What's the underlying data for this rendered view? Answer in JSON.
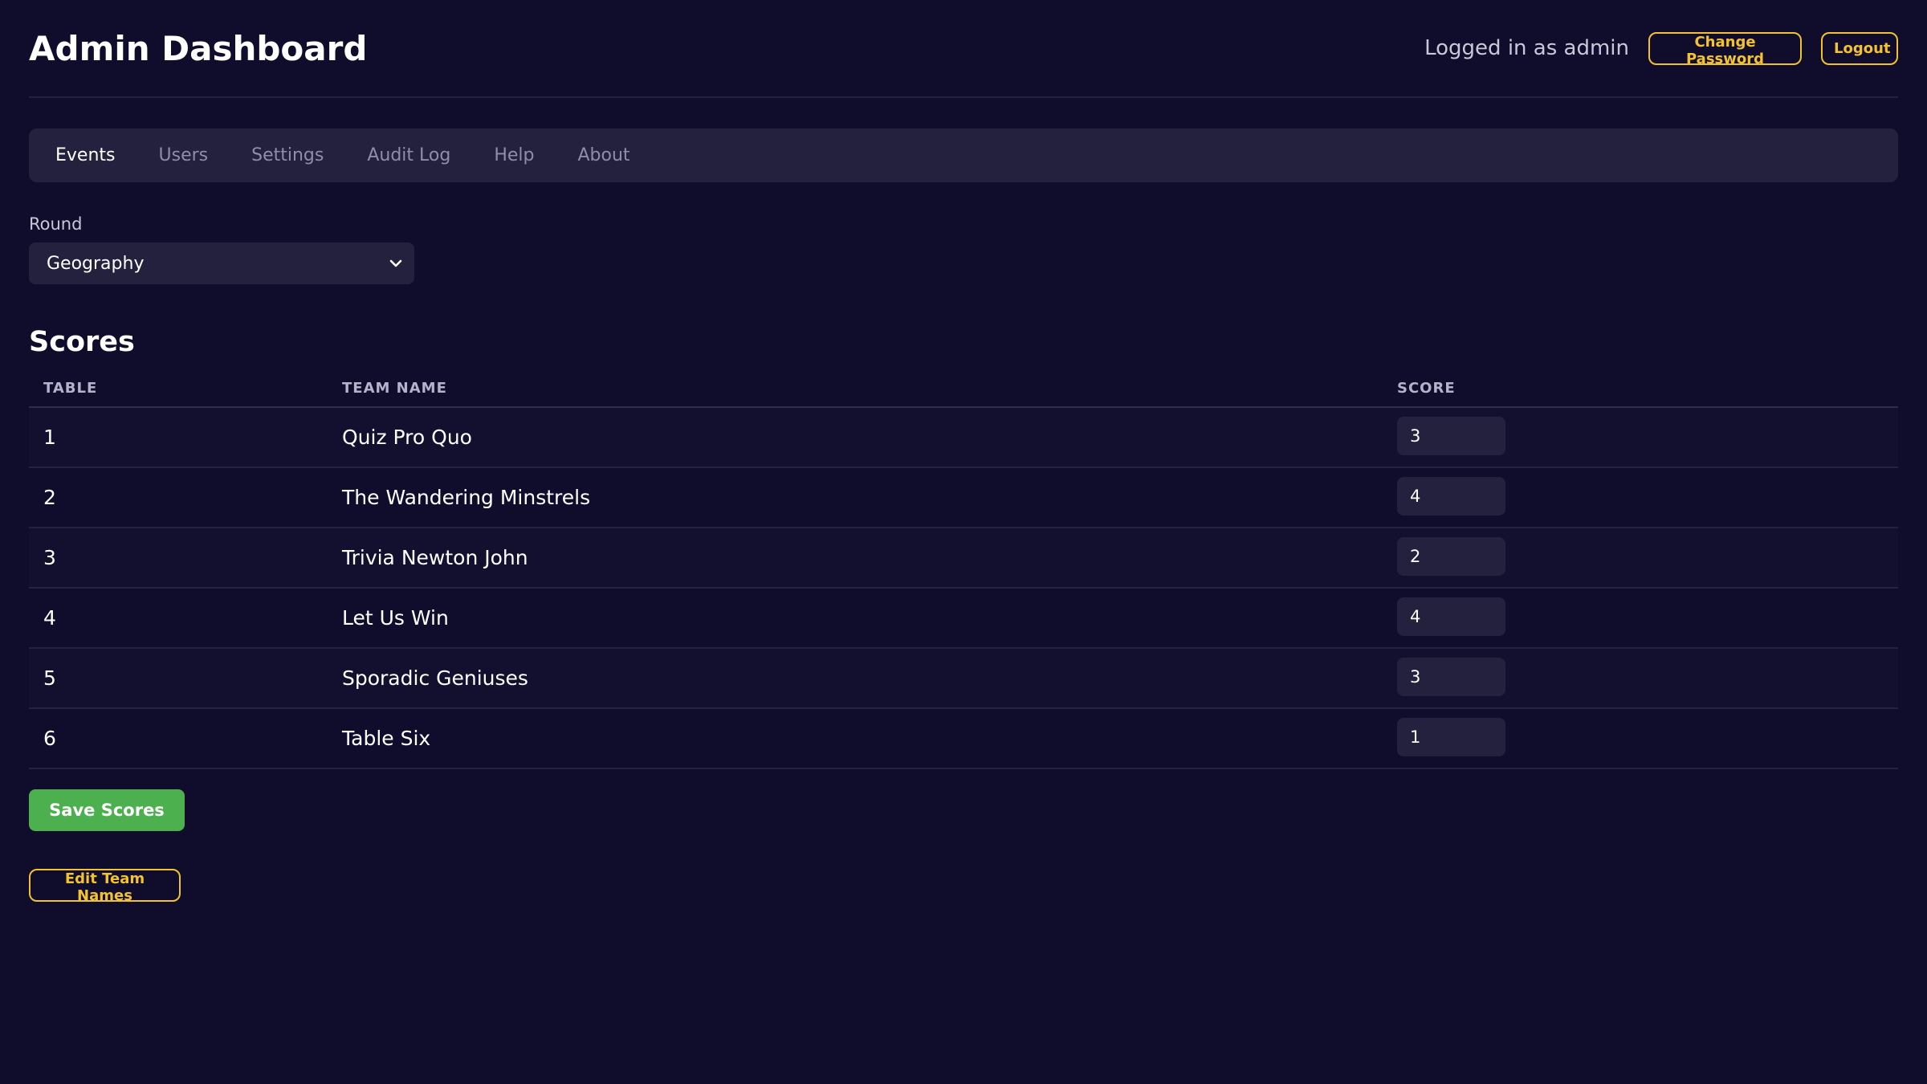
{
  "header": {
    "title": "Admin Dashboard",
    "logged_in_text": "Logged in as admin",
    "change_password_label": "Change Password",
    "logout_label": "Logout"
  },
  "nav": {
    "items": [
      {
        "label": "Events",
        "active": true
      },
      {
        "label": "Users",
        "active": false
      },
      {
        "label": "Settings",
        "active": false
      },
      {
        "label": "Audit Log",
        "active": false
      },
      {
        "label": "Help",
        "active": false
      },
      {
        "label": "About",
        "active": false
      }
    ]
  },
  "round": {
    "label": "Round",
    "selected": "Geography",
    "icon": "chevron-down-icon"
  },
  "scores": {
    "title": "Scores",
    "columns": [
      "TABLE",
      "TEAM NAME",
      "SCORE"
    ],
    "rows": [
      {
        "table": "1",
        "team": "Quiz Pro Quo",
        "score": "3"
      },
      {
        "table": "2",
        "team": "The Wandering Minstrels",
        "score": "4"
      },
      {
        "table": "3",
        "team": "Trivia Newton John",
        "score": "2"
      },
      {
        "table": "4",
        "team": "Let Us Win",
        "score": "4"
      },
      {
        "table": "5",
        "team": "Sporadic Geniuses",
        "score": "3"
      },
      {
        "table": "6",
        "team": "Table Six",
        "score": "1"
      }
    ],
    "save_label": "Save Scores"
  },
  "actions": {
    "edit_team_names_label": "Edit Team Names"
  },
  "colors": {
    "background": "#100d2c",
    "panel": "#24213e",
    "accent_yellow": "#f2c230",
    "save_green": "#4cb04e"
  }
}
